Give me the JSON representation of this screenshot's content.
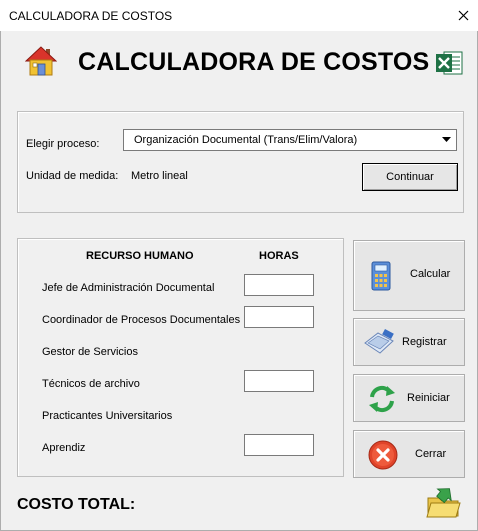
{
  "window": {
    "title": "CALCULADORA DE COSTOS"
  },
  "header": {
    "title": "CALCULADORA DE COSTOS"
  },
  "process": {
    "label": "Elegir proceso:",
    "selected": "Organización Documental (Trans/Elim/Valora)",
    "unit_label": "Unidad de medida:",
    "unit_value": "Metro lineal",
    "continue_label": "Continuar"
  },
  "hr": {
    "header_resource": "RECURSO HUMANO",
    "header_hours": "HORAS",
    "rows": [
      {
        "label": "Jefe de Administración Documental"
      },
      {
        "label": "Coordinador de Procesos Documentales"
      },
      {
        "label": "Gestor de Servicios"
      },
      {
        "label": "Técnicos de archivo"
      },
      {
        "label": "Practicantes Universitarios"
      },
      {
        "label": "Aprendiz"
      }
    ]
  },
  "actions": {
    "calcular": "Calcular",
    "registrar": "Registrar",
    "reiniciar": "Reiniciar",
    "cerrar": "Cerrar"
  },
  "footer": {
    "total_label": "COSTO TOTAL:"
  }
}
